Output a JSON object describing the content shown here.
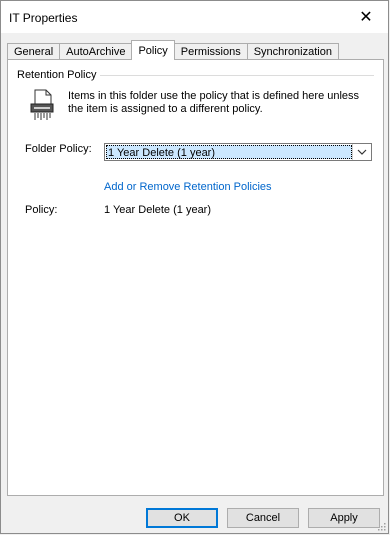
{
  "window": {
    "title": "IT Properties",
    "close_glyph": "✕"
  },
  "tabs": [
    {
      "label": "General",
      "active": false
    },
    {
      "label": "AutoArchive",
      "active": false
    },
    {
      "label": "Policy",
      "active": true
    },
    {
      "label": "Permissions",
      "active": false
    },
    {
      "label": "Synchronization",
      "active": false
    }
  ],
  "retention": {
    "group_label": "Retention Policy",
    "icon": "shredder-icon",
    "description": "Items in this folder use the policy that is defined here unless the item is assigned to a different policy.",
    "folder_policy_label": "Folder Policy:",
    "folder_policy_value": "1 Year Delete (1 year)",
    "link_text": "Add or Remove Retention Policies",
    "policy_label": "Policy:",
    "policy_value": "1 Year Delete (1 year)"
  },
  "buttons": {
    "ok": "OK",
    "cancel": "Cancel",
    "apply": "Apply"
  },
  "colors": {
    "link": "#0066cc",
    "selection": "#cce8ff",
    "default_button_border": "#0078d7"
  }
}
